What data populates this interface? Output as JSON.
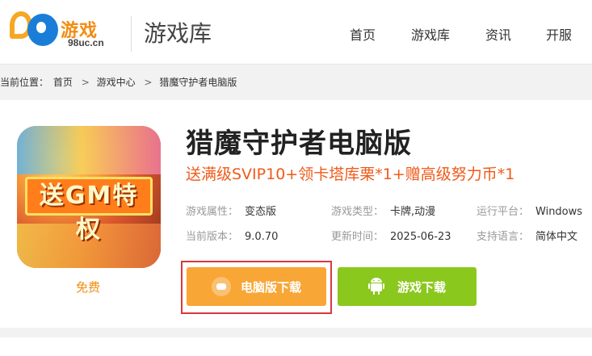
{
  "header": {
    "logo_brand": "游戏",
    "logo_domain": "98uc.cn",
    "site_title": "游戏库",
    "nav": [
      "首页",
      "游戏库",
      "资讯",
      "开服"
    ]
  },
  "breadcrumb": {
    "prefix": "当前位置：",
    "items": [
      "首页",
      "游戏中心",
      "猎魔守护者电脑版"
    ]
  },
  "game": {
    "cover_text": "送GM特权",
    "free_label": "免费",
    "title": "猎魔守护者电脑版",
    "promo": "送满级SVIP10+领卡塔库栗*1+赠高级努力币*1",
    "info": {
      "attr_label": "游戏属性：",
      "attr_value": "变态版",
      "type_label": "游戏类型：",
      "type_value": "卡牌,动漫",
      "platform_label": "运行平台：",
      "platform_value": "Windows",
      "version_label": "当前版本：",
      "version_value": "9.0.70",
      "update_label": "更新时间：",
      "update_value": "2025-06-23",
      "lang_label": "支持语言：",
      "lang_value": "简体中文"
    }
  },
  "buttons": {
    "pc_download": "电脑版下载",
    "game_download": "游戏下载"
  },
  "colors": {
    "brand_orange": "#f28c12",
    "pc_button": "#f8a636",
    "game_button": "#8bc81e",
    "highlight_border": "#d8393b",
    "promo_text": "#f05a1a"
  }
}
